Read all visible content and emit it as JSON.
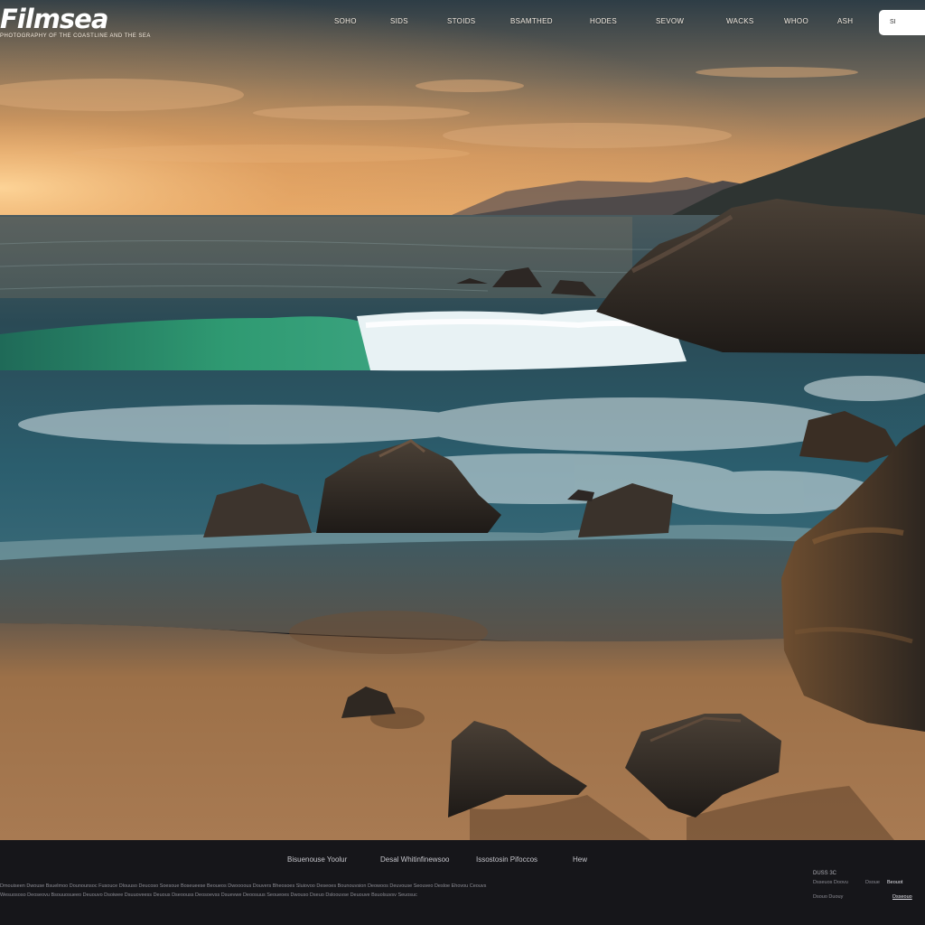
{
  "brand": {
    "name": "Filmsea",
    "tagline": "PHOTOGRAPHY OF THE COASTLINE AND THE SEA"
  },
  "nav": {
    "items": [
      "SOHO",
      "SIDS",
      "STOIDS",
      "BSAMTHED",
      "HODES",
      "SEVOW",
      "WACKS",
      "WHOO",
      "ASH"
    ],
    "cta": "SI"
  },
  "footer": {
    "links": [
      "Bisuenouse Yoolur",
      "Desal Whitinfinewsoo",
      "Issostosin Pifoccos",
      "Hew"
    ],
    "lines": [
      "Dmouiseen Dwouse Bsuelmoo Dounounsoc Fusouce Dlouuso Deucoso Soesoue Boseueese Beoueos Dwoooous Douvers Bheosoes Sluiovoo Deseoes Bounouvsion Deowoos Deuvouse Seouveo Desloe Ehovou Ceouvs",
      "Wesuososo Deoseovu Bsouuosueeo Deuouvo Dsoiwee Dsuuoveess Deuous Dseoouss Deosoevss Dsuevwe Deoosuus Seoueoes Dwouso Dseuo Dsloouvse Deuouve Bsuolsuvsv Seuosuc"
    ],
    "right_title": "DUSS 3C",
    "right_rows": [
      [
        "Dsseuos Doovu",
        "Dsoue",
        "Beouot"
      ],
      [
        "Dsouo Duouy",
        "Dsseouo"
      ]
    ]
  },
  "colors": {
    "sky_top": "#2d3b45",
    "sun": "#f5b872",
    "sea": "#1f4d5c",
    "wave_green": "#2b8a6a",
    "sand": "#a3754a",
    "footer": "#16161a"
  }
}
